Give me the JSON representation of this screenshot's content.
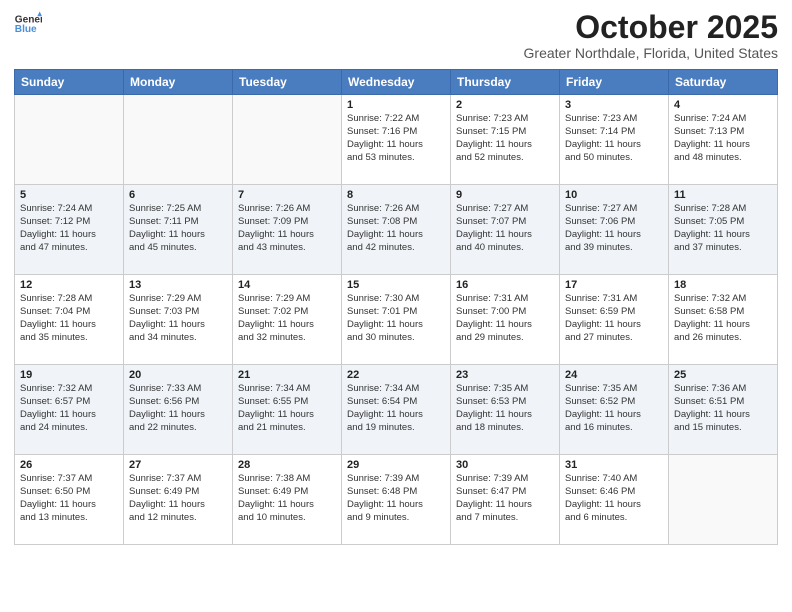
{
  "header": {
    "logo_line1": "General",
    "logo_line2": "Blue",
    "title": "October 2025",
    "subtitle": "Greater Northdale, Florida, United States"
  },
  "days_of_week": [
    "Sunday",
    "Monday",
    "Tuesday",
    "Wednesday",
    "Thursday",
    "Friday",
    "Saturday"
  ],
  "weeks": [
    [
      {
        "day": "",
        "info": ""
      },
      {
        "day": "",
        "info": ""
      },
      {
        "day": "",
        "info": ""
      },
      {
        "day": "1",
        "info": "Sunrise: 7:22 AM\nSunset: 7:16 PM\nDaylight: 11 hours\nand 53 minutes."
      },
      {
        "day": "2",
        "info": "Sunrise: 7:23 AM\nSunset: 7:15 PM\nDaylight: 11 hours\nand 52 minutes."
      },
      {
        "day": "3",
        "info": "Sunrise: 7:23 AM\nSunset: 7:14 PM\nDaylight: 11 hours\nand 50 minutes."
      },
      {
        "day": "4",
        "info": "Sunrise: 7:24 AM\nSunset: 7:13 PM\nDaylight: 11 hours\nand 48 minutes."
      }
    ],
    [
      {
        "day": "5",
        "info": "Sunrise: 7:24 AM\nSunset: 7:12 PM\nDaylight: 11 hours\nand 47 minutes."
      },
      {
        "day": "6",
        "info": "Sunrise: 7:25 AM\nSunset: 7:11 PM\nDaylight: 11 hours\nand 45 minutes."
      },
      {
        "day": "7",
        "info": "Sunrise: 7:26 AM\nSunset: 7:09 PM\nDaylight: 11 hours\nand 43 minutes."
      },
      {
        "day": "8",
        "info": "Sunrise: 7:26 AM\nSunset: 7:08 PM\nDaylight: 11 hours\nand 42 minutes."
      },
      {
        "day": "9",
        "info": "Sunrise: 7:27 AM\nSunset: 7:07 PM\nDaylight: 11 hours\nand 40 minutes."
      },
      {
        "day": "10",
        "info": "Sunrise: 7:27 AM\nSunset: 7:06 PM\nDaylight: 11 hours\nand 39 minutes."
      },
      {
        "day": "11",
        "info": "Sunrise: 7:28 AM\nSunset: 7:05 PM\nDaylight: 11 hours\nand 37 minutes."
      }
    ],
    [
      {
        "day": "12",
        "info": "Sunrise: 7:28 AM\nSunset: 7:04 PM\nDaylight: 11 hours\nand 35 minutes."
      },
      {
        "day": "13",
        "info": "Sunrise: 7:29 AM\nSunset: 7:03 PM\nDaylight: 11 hours\nand 34 minutes."
      },
      {
        "day": "14",
        "info": "Sunrise: 7:29 AM\nSunset: 7:02 PM\nDaylight: 11 hours\nand 32 minutes."
      },
      {
        "day": "15",
        "info": "Sunrise: 7:30 AM\nSunset: 7:01 PM\nDaylight: 11 hours\nand 30 minutes."
      },
      {
        "day": "16",
        "info": "Sunrise: 7:31 AM\nSunset: 7:00 PM\nDaylight: 11 hours\nand 29 minutes."
      },
      {
        "day": "17",
        "info": "Sunrise: 7:31 AM\nSunset: 6:59 PM\nDaylight: 11 hours\nand 27 minutes."
      },
      {
        "day": "18",
        "info": "Sunrise: 7:32 AM\nSunset: 6:58 PM\nDaylight: 11 hours\nand 26 minutes."
      }
    ],
    [
      {
        "day": "19",
        "info": "Sunrise: 7:32 AM\nSunset: 6:57 PM\nDaylight: 11 hours\nand 24 minutes."
      },
      {
        "day": "20",
        "info": "Sunrise: 7:33 AM\nSunset: 6:56 PM\nDaylight: 11 hours\nand 22 minutes."
      },
      {
        "day": "21",
        "info": "Sunrise: 7:34 AM\nSunset: 6:55 PM\nDaylight: 11 hours\nand 21 minutes."
      },
      {
        "day": "22",
        "info": "Sunrise: 7:34 AM\nSunset: 6:54 PM\nDaylight: 11 hours\nand 19 minutes."
      },
      {
        "day": "23",
        "info": "Sunrise: 7:35 AM\nSunset: 6:53 PM\nDaylight: 11 hours\nand 18 minutes."
      },
      {
        "day": "24",
        "info": "Sunrise: 7:35 AM\nSunset: 6:52 PM\nDaylight: 11 hours\nand 16 minutes."
      },
      {
        "day": "25",
        "info": "Sunrise: 7:36 AM\nSunset: 6:51 PM\nDaylight: 11 hours\nand 15 minutes."
      }
    ],
    [
      {
        "day": "26",
        "info": "Sunrise: 7:37 AM\nSunset: 6:50 PM\nDaylight: 11 hours\nand 13 minutes."
      },
      {
        "day": "27",
        "info": "Sunrise: 7:37 AM\nSunset: 6:49 PM\nDaylight: 11 hours\nand 12 minutes."
      },
      {
        "day": "28",
        "info": "Sunrise: 7:38 AM\nSunset: 6:49 PM\nDaylight: 11 hours\nand 10 minutes."
      },
      {
        "day": "29",
        "info": "Sunrise: 7:39 AM\nSunset: 6:48 PM\nDaylight: 11 hours\nand 9 minutes."
      },
      {
        "day": "30",
        "info": "Sunrise: 7:39 AM\nSunset: 6:47 PM\nDaylight: 11 hours\nand 7 minutes."
      },
      {
        "day": "31",
        "info": "Sunrise: 7:40 AM\nSunset: 6:46 PM\nDaylight: 11 hours\nand 6 minutes."
      },
      {
        "day": "",
        "info": ""
      }
    ]
  ]
}
